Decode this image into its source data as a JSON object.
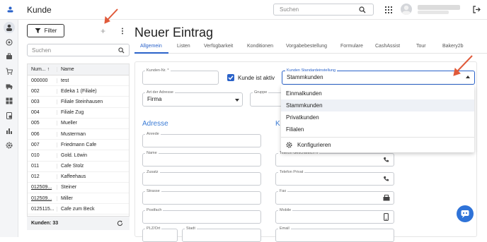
{
  "app": {
    "title": "Kunde",
    "search_placeholder": "Suchen",
    "user_name_blurred": "",
    "icons": [
      "menu-icon",
      "search-icon",
      "apps-grid-icon",
      "avatar",
      "logout-icon"
    ]
  },
  "rail": {
    "icons": [
      "person-icon",
      "target-icon",
      "briefcase-icon",
      "cart-icon",
      "truck-icon",
      "grid-icon",
      "receipt-icon",
      "bar-chart-icon",
      "gear-icon"
    ]
  },
  "list": {
    "filter_label": "Filter",
    "search_placeholder": "Suchen",
    "col_number": "Num...",
    "col_name": "Name",
    "rows": [
      {
        "num": "000000",
        "name": "test"
      },
      {
        "num": "002",
        "name": "Edeka 1 (Filiale)"
      },
      {
        "num": "003",
        "name": "Filiale Steinhausen"
      },
      {
        "num": "004",
        "name": "Filiale Zug"
      },
      {
        "num": "005",
        "name": "Mueller"
      },
      {
        "num": "006",
        "name": "Musterman"
      },
      {
        "num": "007",
        "name": "Friedmann Cafe"
      },
      {
        "num": "010",
        "name": "Gold. Löwin"
      },
      {
        "num": "011",
        "name": "Cafe Stolz"
      },
      {
        "num": "012",
        "name": "Kaffeehaus"
      },
      {
        "num": "012509...",
        "name": "Steiner"
      },
      {
        "num": "012509...",
        "name": "Miller"
      },
      {
        "num": "0125115...",
        "name": "Cafe zum Beck"
      }
    ],
    "footer": "Kunden: 33"
  },
  "main": {
    "heading": "Neuer Eintrag",
    "tabs": [
      "Allgemein",
      "Listen",
      "Verfügbarkeit",
      "Konditionen",
      "Vorgabebestellung",
      "Formulare",
      "CashAssist",
      "Tour",
      "Bakery2b"
    ],
    "active_tab": "Allgemein"
  },
  "form": {
    "kunden_nr_label": "Kunden-Nr. *",
    "kunde_aktiv_label": "Kunde ist aktiv",
    "standard_label": "Kunden Standardeinstellung",
    "standard_value": "Stammkunden",
    "art_label": "Art der Adresse",
    "art_value": "Firma",
    "gruppe_label": "Gruppe",
    "section_address": "Adresse",
    "section_contact": "K",
    "left_fields": [
      "Anrede",
      "Name",
      "Zusatz",
      "Strasse",
      "Postfach",
      "PLZ/Ort",
      "Stadt"
    ],
    "right_fields": [
      "Telefon Geschäftlich II",
      "Telefon Privat",
      "Fax",
      "Mobile",
      "Email"
    ]
  },
  "dropdown": {
    "items": [
      "Einmalkunden",
      "Stammkunden",
      "Privatkunden",
      "Filialen"
    ],
    "highlighted": "Stammkunden",
    "configure_label": "Konfigurieren"
  },
  "colors": {
    "accent": "#2a62c9",
    "section": "#3a7bd5",
    "arrow": "#e05a3a",
    "fab": "#2f73d8"
  }
}
